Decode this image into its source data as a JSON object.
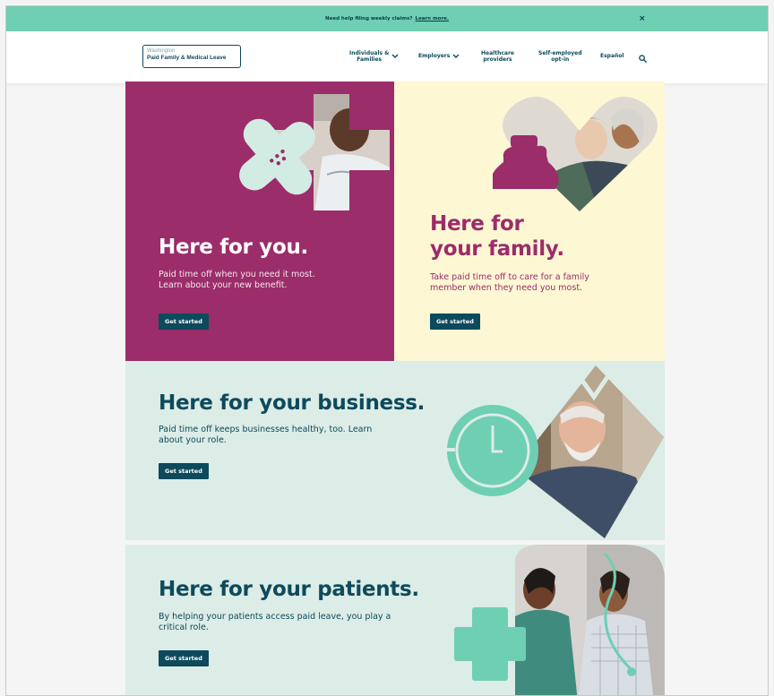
{
  "banner": {
    "text": "Need help filing weekly claims?",
    "link": "Learn more.",
    "close_glyph": "×"
  },
  "header": {
    "logo_line1": "Washington",
    "logo_line2": "Paid Family & Medical Leave",
    "nav": [
      {
        "label": "Individuals & Families",
        "has_dropdown": true
      },
      {
        "label": "Employers",
        "has_dropdown": true
      },
      {
        "label": "Healthcare providers",
        "has_dropdown": false
      },
      {
        "label": "Self-employed opt-in",
        "has_dropdown": false
      },
      {
        "label": "Español",
        "has_dropdown": false
      }
    ],
    "nav_line1": [
      "Individuals &",
      "Healthcare",
      "Self-employed"
    ],
    "nav_line2": [
      "Families",
      "providers",
      "opt-in"
    ],
    "search_icon": "search-icon"
  },
  "panels": {
    "you": {
      "title": "Here for you.",
      "text": "Paid time off when you need it most. Learn about your new benefit.",
      "line1": "Paid time off when you need it most.",
      "line2": "Learn about your new benefit.",
      "button": "Get started",
      "bg": "#9b2d6a"
    },
    "family": {
      "title1": "Here for",
      "title2": "your family.",
      "line1": "Take paid time off to care for a family",
      "line2": "member when they need you most.",
      "button": "Get started",
      "bg": "#fdf7d4"
    },
    "business": {
      "title": "Here for your business.",
      "line1": "Paid time off keeps businesses healthy, too. Learn",
      "line2": "about your role.",
      "button": "Get started",
      "bg": "#dcece6"
    },
    "patients": {
      "title": "Here for your patients.",
      "line1": "By helping your patients access paid leave, you play a",
      "line2": "critical role.",
      "button": "Get started",
      "bg": "#dcece6"
    }
  },
  "colors": {
    "accent_teal": "#6ecfb3",
    "navy": "#0d4a5c",
    "magenta": "#9b2d6a"
  }
}
